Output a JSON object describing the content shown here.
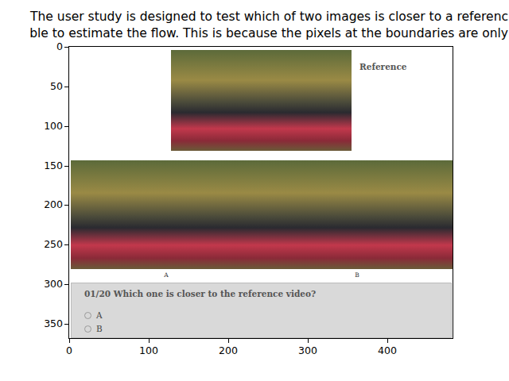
{
  "figure": {
    "title_lines": [
      "The user study is designed to test which of two images is closer to a referenc",
      "ble to estimate the flow. This is because the pixels at the boundaries are only"
    ]
  },
  "axes": {
    "x_ticks": [
      "0",
      "100",
      "200",
      "300",
      "400"
    ],
    "y_ticks": [
      "0",
      "50",
      "100",
      "150",
      "200",
      "250",
      "300",
      "350"
    ]
  },
  "image": {
    "reference_label": "Reference",
    "candidates": [
      {
        "label": "A"
      },
      {
        "label": "B"
      }
    ],
    "question": "01/20 Which one is closer to the reference video?",
    "options": [
      {
        "label": "A",
        "selected": false
      },
      {
        "label": "B",
        "selected": false
      }
    ]
  }
}
